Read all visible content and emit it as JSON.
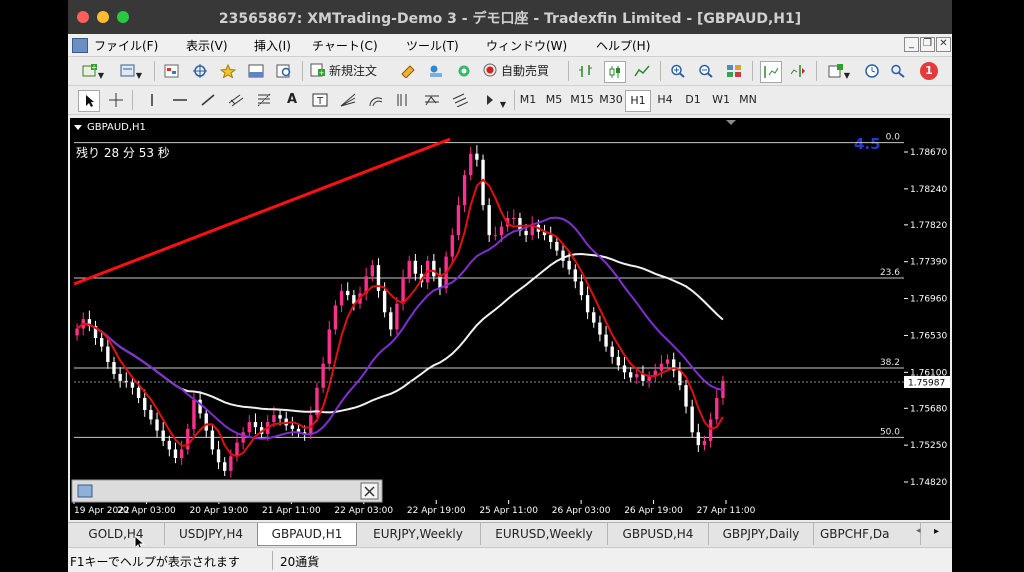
{
  "window": {
    "title": "23565867: XMTrading-Demo 3 - デモ口座 - Tradexfin Limited - [GBPAUD,H1]"
  },
  "menu": [
    "ファイル(F)",
    "表示(V)",
    "挿入(I)",
    "チャート(C)",
    "ツール(T)",
    "ウィンドウ(W)",
    "ヘルプ(H)"
  ],
  "toolbar": {
    "new_order": "新規注文",
    "auto_trade": "自動売買",
    "notification_count": "1",
    "text_tool": "A"
  },
  "timeframes": [
    "M1",
    "M5",
    "M15",
    "M30",
    "H1",
    "H4",
    "D1",
    "W1",
    "MN"
  ],
  "active_timeframe": "H1",
  "chart": {
    "symbol_label": "GBPAUD,H1",
    "countdown": "残り 28 分 53 秒",
    "top_value": "4.5",
    "price_axis": [
      "1.78670",
      "1.78240",
      "1.77820",
      "1.77390",
      "1.76960",
      "1.76530",
      "1.76100",
      "1.75680",
      "1.75250",
      "1.74820"
    ],
    "current_price": "1.75987",
    "fib_levels": [
      {
        "label": "0.0",
        "price": 1.7878
      },
      {
        "label": "23.6",
        "price": 1.772
      },
      {
        "label": "38.2",
        "price": 1.7615
      },
      {
        "label": "50.0",
        "price": 1.7534
      }
    ],
    "time_axis": [
      "19 Apr 2022",
      "20 Apr 03:00",
      "20 Apr 19:00",
      "21 Apr 11:00",
      "22 Apr 03:00",
      "22 Apr 19:00",
      "25 Apr 11:00",
      "26 Apr 03:00",
      "26 Apr 19:00",
      "27 Apr 11:00"
    ],
    "colors": {
      "bull": "#ff2f8e",
      "bear": "#ffffff",
      "ma_fast": "#e01010",
      "ma_slow": "#7e2fd0",
      "ma_long": "#f0f0f0",
      "trendline": "#ff1010"
    },
    "closes": [
      1.7661,
      1.7672,
      1.7664,
      1.765,
      1.764,
      1.7622,
      1.7608,
      1.76,
      1.7598,
      1.7592,
      1.758,
      1.7566,
      1.7555,
      1.7542,
      1.753,
      1.752,
      1.751,
      1.752,
      1.7544,
      1.7578,
      1.7562,
      1.7542,
      1.752,
      1.7505,
      1.7495,
      1.7512,
      1.7528,
      1.754,
      1.7552,
      1.7546,
      1.7538,
      1.7552,
      1.756,
      1.7556,
      1.7548,
      1.7544,
      1.754,
      1.7538,
      1.756,
      1.7592,
      1.762,
      1.766,
      1.7688,
      1.7705,
      1.77,
      1.769,
      1.7702,
      1.7722,
      1.7735,
      1.7705,
      1.768,
      1.766,
      1.769,
      1.772,
      1.774,
      1.7725,
      1.7715,
      1.774,
      1.7722,
      1.7708,
      1.7745,
      1.777,
      1.7805,
      1.784,
      1.7865,
      1.7858,
      1.7805,
      1.777,
      1.777,
      1.778,
      1.779,
      1.779,
      1.7775,
      1.777,
      1.7782,
      1.7774,
      1.777,
      1.7762,
      1.7752,
      1.774,
      1.773,
      1.7716,
      1.77,
      1.768,
      1.7668,
      1.7654,
      1.764,
      1.7628,
      1.7618,
      1.761,
      1.7604,
      1.7608,
      1.76,
      1.7605,
      1.7612,
      1.762,
      1.7625,
      1.7612,
      1.7595,
      1.757,
      1.754,
      1.7525,
      1.753,
      1.7555,
      1.758,
      1.76
    ]
  },
  "tabs": [
    "GOLD,H4",
    "USDJPY,H4",
    "GBPAUD,H1",
    "EURJPY,Weekly",
    "EURUSD,Weekly",
    "GBPUSD,H4",
    "GBPJPY,Daily",
    "GBPCHF,Da"
  ],
  "active_tab": "GBPAUD,H1",
  "status": {
    "help": "F1キーでヘルプが表示されます",
    "template": "20通貨"
  }
}
